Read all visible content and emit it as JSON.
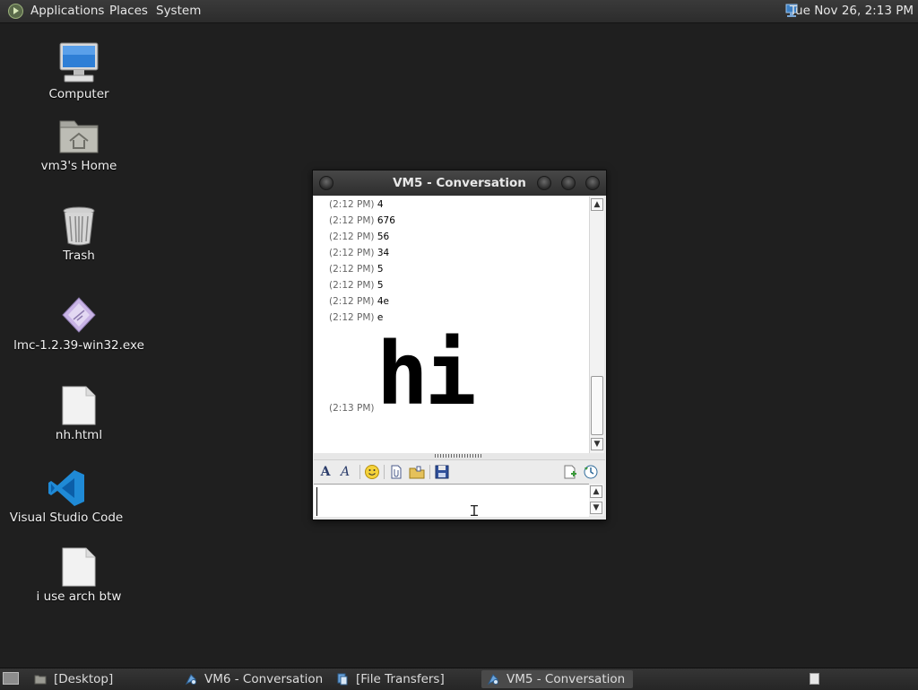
{
  "top_panel": {
    "menus": [
      "Applications",
      "Places",
      "System"
    ],
    "clock": "Tue Nov 26,  2:13 PM",
    "icons": {
      "logo": "gnome-foot-icon",
      "network": "network-icon"
    }
  },
  "desktop_icons": [
    {
      "label": "Computer",
      "icon": "computer-icon"
    },
    {
      "label": "vm3's Home",
      "icon": "home-folder-icon"
    },
    {
      "label": "Trash",
      "icon": "trash-icon"
    },
    {
      "label": "lmc-1.2.39-win32.exe",
      "icon": "executable-icon"
    },
    {
      "label": "nh.html",
      "icon": "file-icon"
    },
    {
      "label": "Visual Studio Code",
      "icon": "vscode-icon"
    },
    {
      "label": "i use arch btw",
      "icon": "file-icon"
    }
  ],
  "conversation_window": {
    "title": "VM5 - Conversation",
    "messages": [
      {
        "time": "(2:12 PM)",
        "text": "4"
      },
      {
        "time": "(2:12 PM)",
        "text": "676"
      },
      {
        "time": "(2:12 PM)",
        "text": "56"
      },
      {
        "time": "(2:12 PM)",
        "text": "34"
      },
      {
        "time": "(2:12 PM)",
        "text": "5"
      },
      {
        "time": "(2:12 PM)",
        "text": "5"
      },
      {
        "time": "(2:12 PM)",
        "text": "4e"
      },
      {
        "time": "(2:12 PM)",
        "text": "e"
      },
      {
        "time": "(2:13 PM)",
        "text": "hi"
      }
    ],
    "toolbar_icons": [
      "font-icon",
      "font-style-icon",
      "smiley-icon",
      "attach-file-icon",
      "send-folder-icon",
      "save-icon",
      "clear-icon",
      "history-icon"
    ],
    "input_value": ""
  },
  "taskbar": {
    "tasks": [
      {
        "label": "[Desktop]",
        "icon": "folder-icon",
        "active": false
      },
      {
        "label": "VM6 - Conversation",
        "icon": "chat-icon",
        "active": false
      },
      {
        "label": "[File Transfers]",
        "icon": "transfer-icon",
        "active": false
      },
      {
        "label": "VM5 - Conversation",
        "icon": "chat-icon",
        "active": true
      }
    ]
  },
  "colors": {
    "desktop_bg": "#1f1f1f",
    "panel_bg": "#2f2f2f",
    "window_title_bg": "#3a3a3a",
    "chat_bg": "#ffffff"
  }
}
